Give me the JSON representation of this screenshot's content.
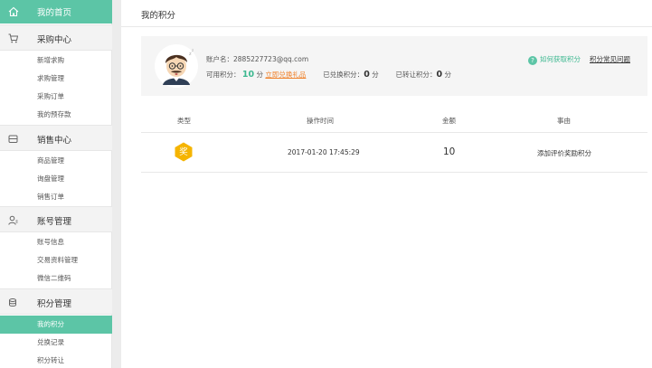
{
  "sidebar": {
    "home_label": "我的首页",
    "sections": [
      {
        "label": "采购中心",
        "icon": "cart-icon",
        "items": [
          "新增求购",
          "求购管理",
          "采购订单",
          "我的预存款"
        ]
      },
      {
        "label": "销售中心",
        "icon": "wallet-icon",
        "items": [
          "商品管理",
          "询盘管理",
          "销售订单"
        ]
      },
      {
        "label": "账号管理",
        "icon": "user-icon",
        "items": [
          "账号信息",
          "交易资料管理",
          "微信二维码"
        ]
      },
      {
        "label": "积分管理",
        "icon": "coins-icon",
        "items": [
          "我的积分",
          "兑换记录",
          "积分转让"
        ]
      }
    ],
    "active_item": "我的积分"
  },
  "main": {
    "title": "我的积分",
    "user": {
      "account_label": "账户名：",
      "account": "2885227723@qq.com",
      "available_label": "可用积分：",
      "available": "10",
      "unit": "分",
      "redeem_link": "立即兑换礼品",
      "redeemed_label": "已兑换积分：",
      "redeemed": "0",
      "transferred_label": "已转让积分：",
      "transferred": "0"
    },
    "help": {
      "how_to_earn": "如何获取积分",
      "faq": "积分常见问题"
    },
    "table": {
      "headers": [
        "类型",
        "操作时间",
        "金额",
        "事由"
      ],
      "rows": [
        {
          "type": "奖",
          "time": "2017-01-20 17:45:29",
          "amount": "10",
          "reason": "添加评价奖励积分"
        }
      ]
    }
  },
  "colors": {
    "accent": "#5cc5a6",
    "link_green": "#3db890",
    "link_orange": "#f0822c",
    "badge": "#f5b400"
  }
}
